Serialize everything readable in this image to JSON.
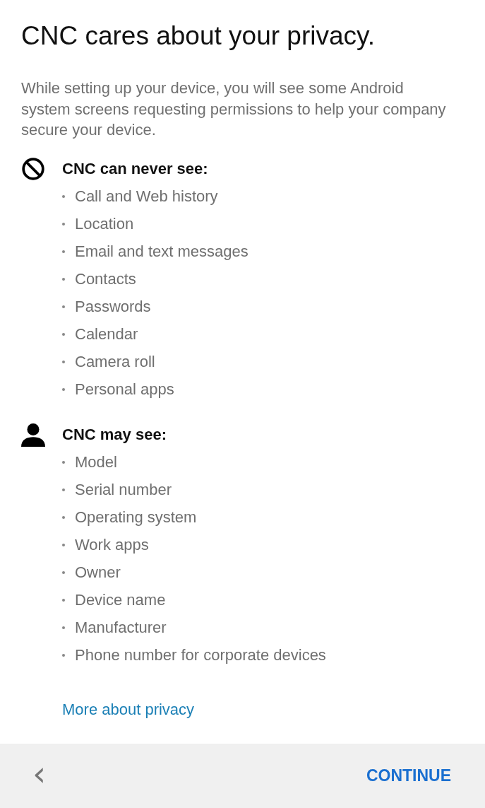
{
  "title": "CNC cares about your privacy.",
  "intro": "While setting up your device, you will see some Android system screens requesting permissions to help your company secure your device.",
  "sections": [
    {
      "kind": "never",
      "heading": "CNC can never see:",
      "items": [
        "Call and Web history",
        "Location",
        "Email and text messages",
        "Contacts",
        "Passwords",
        "Calendar",
        "Camera roll",
        "Personal apps"
      ]
    },
    {
      "kind": "may",
      "heading": "CNC may see:",
      "items": [
        "Model",
        "Serial number",
        "Operating system",
        "Work apps",
        "Owner",
        "Device name",
        "Manufacturer",
        "Phone number for corporate devices"
      ]
    }
  ],
  "link": "More about privacy",
  "footer": {
    "back": "‹",
    "continue": "CONTINUE"
  }
}
